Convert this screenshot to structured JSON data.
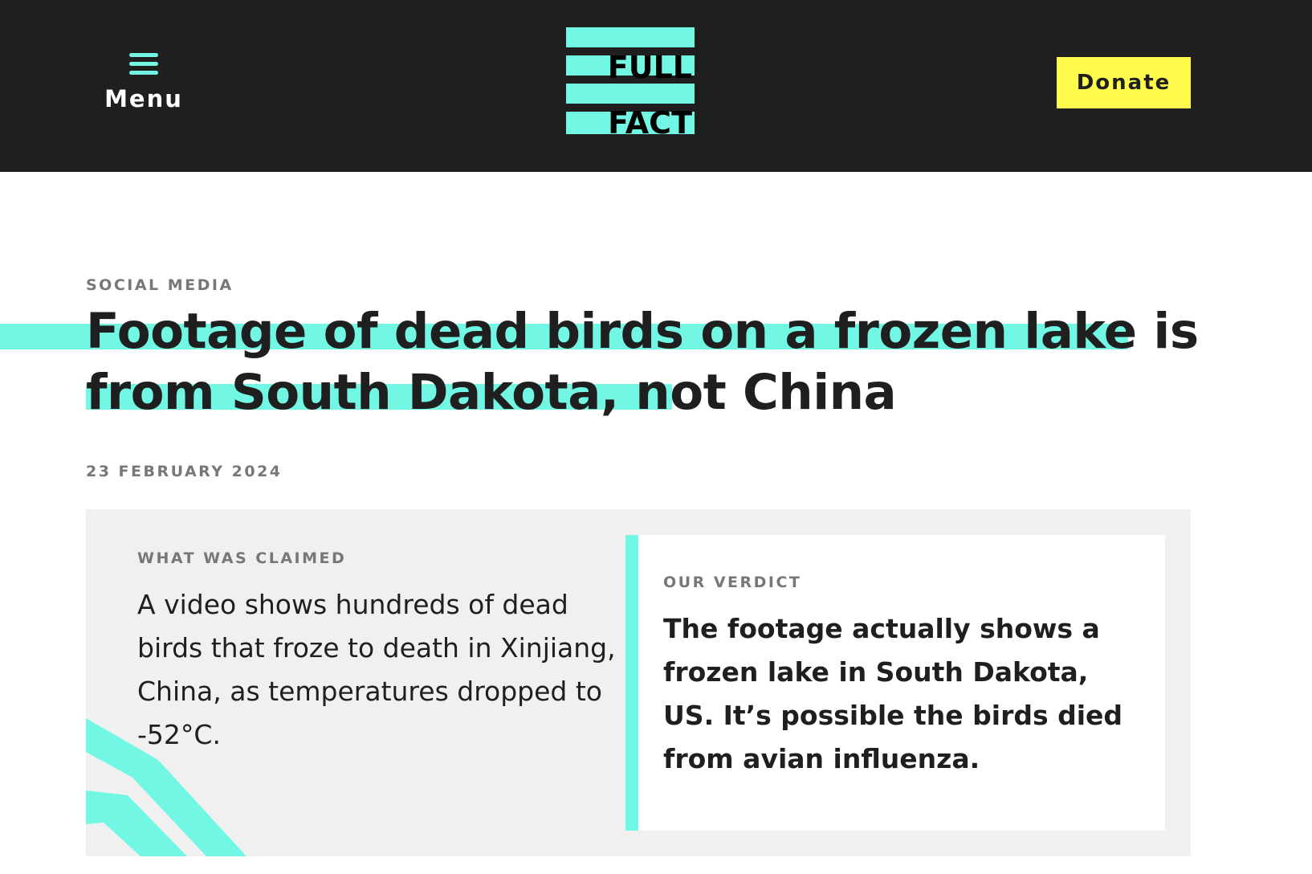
{
  "header": {
    "menu_label": "Menu",
    "logo_text_line1": "FULL",
    "logo_text_line2": "FACT",
    "donate_label": "Donate",
    "colors": {
      "background": "#1f1f1f",
      "accent": "#72f7e4",
      "donate": "#fefb4c"
    }
  },
  "article": {
    "category": "SOCIAL MEDIA",
    "title": "Footage of dead birds on a frozen lake is from South Dakota, not China",
    "date": "23 FEBRUARY 2024"
  },
  "claim": {
    "label": "WHAT WAS CLAIMED",
    "text": "A video shows hundreds of dead birds that froze to death in Xinjiang, China, as temperatures dropped to -52°C."
  },
  "verdict": {
    "label": "OUR VERDICT",
    "text": "The footage actually shows a frozen lake in South Dakota, US. It’s possible the birds died from avian influenza."
  },
  "icons": {
    "menu": "hamburger-icon"
  }
}
